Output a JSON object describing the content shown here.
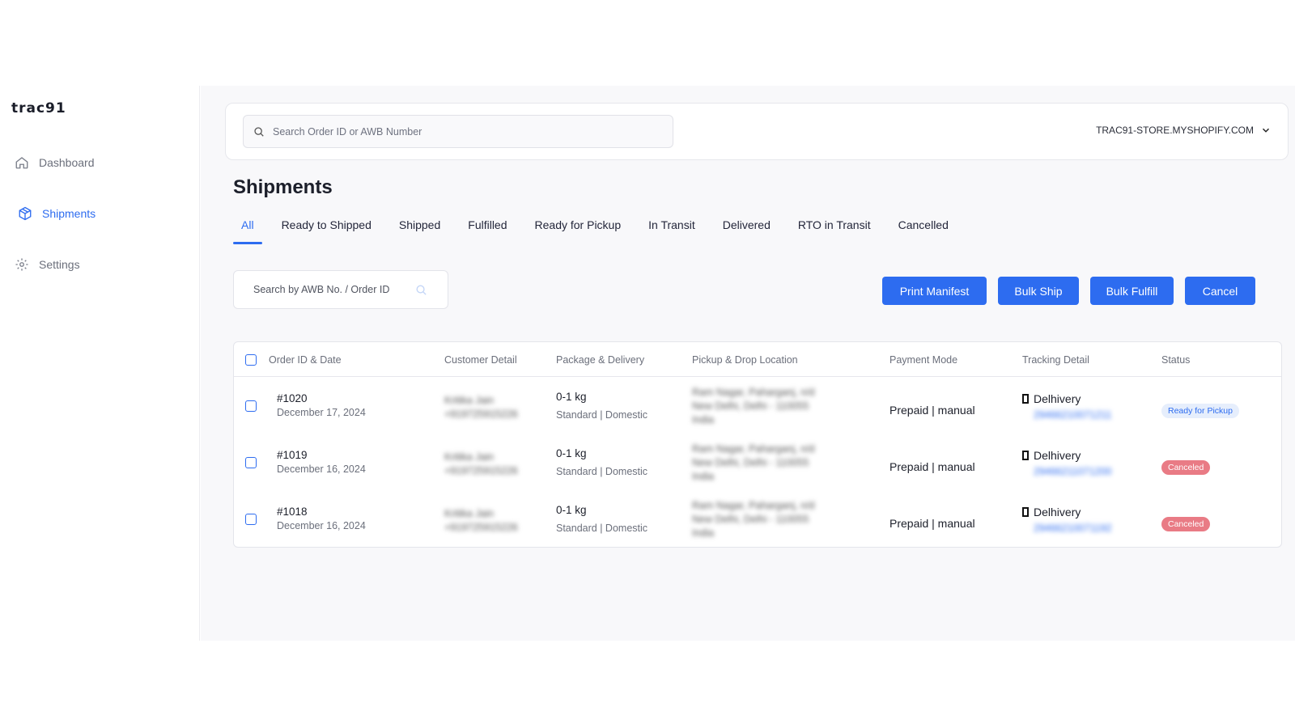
{
  "app": {
    "logo": "trac91"
  },
  "sidebar": {
    "items": [
      {
        "label": "Dashboard",
        "icon": "home-icon"
      },
      {
        "label": "Shipments",
        "icon": "package-icon",
        "active": true
      },
      {
        "label": "Settings",
        "icon": "gear-icon"
      }
    ]
  },
  "topbar": {
    "search_placeholder": "Search Order ID or AWB Number",
    "store_name": "TRAC91-STORE.MYSHOPIFY.COM"
  },
  "page": {
    "title": "Shipments"
  },
  "tabs": [
    {
      "label": "All",
      "active": true
    },
    {
      "label": "Ready to Shipped"
    },
    {
      "label": "Shipped"
    },
    {
      "label": "Fulfilled"
    },
    {
      "label": "Ready for Pickup"
    },
    {
      "label": "In Transit"
    },
    {
      "label": "Delivered"
    },
    {
      "label": "RTO in Transit"
    },
    {
      "label": "Cancelled"
    }
  ],
  "filter": {
    "search_placeholder": "Search by AWB No. / Order ID"
  },
  "actions": {
    "print_manifest": "Print Manifest",
    "bulk_ship": "Bulk Ship",
    "bulk_fulfill": "Bulk Fulfill",
    "cancel": "Cancel"
  },
  "table": {
    "headers": {
      "order": "Order ID & Date",
      "customer": "Customer Detail",
      "package": "Package & Delivery",
      "location": "Pickup & Drop Location",
      "payment": "Payment Mode",
      "tracking": "Tracking Detail",
      "status": "Status"
    },
    "rows": [
      {
        "order_id": "#1020",
        "date": "December 17, 2024",
        "customer_name": "Kritika Jain",
        "customer_phone": "+919725915226",
        "weight": "0-1 kg",
        "delivery": "Standard | Domestic",
        "location_1": "Ram Nagar, Paharganj, n/d",
        "location_2": "New Delhi, Delhi - 110055",
        "location_3": "India",
        "payment": "Prepaid | manual",
        "courier": "Delhivery",
        "awb": "29466210071211",
        "status": "Ready for Pickup",
        "status_type": "ready"
      },
      {
        "order_id": "#1019",
        "date": "December 16, 2024",
        "customer_name": "Kritika Jain",
        "customer_phone": "+919725915226",
        "weight": "0-1 kg",
        "delivery": "Standard | Domestic",
        "location_1": "Ram Nagar, Paharganj, n/d",
        "location_2": "New Delhi, Delhi - 110055",
        "location_3": "India",
        "payment": "Prepaid | manual",
        "courier": "Delhivery",
        "awb": "29466211071200",
        "status": "Canceled",
        "status_type": "cancel"
      },
      {
        "order_id": "#1018",
        "date": "December 16, 2024",
        "customer_name": "Kritika Jain",
        "customer_phone": "+919725915226",
        "weight": "0-1 kg",
        "delivery": "Standard | Domestic",
        "location_1": "Ram Nagar, Paharganj, n/d",
        "location_2": "New Delhi, Delhi - 110055",
        "location_3": "India",
        "payment": "Prepaid | manual",
        "courier": "Delhivery",
        "awb": "29466210071192",
        "status": "Canceled",
        "status_type": "cancel"
      }
    ]
  },
  "colors": {
    "accent": "#2d6cf0",
    "cancel_badge": "#e97b85",
    "ready_badge_bg": "#e6eefc"
  }
}
